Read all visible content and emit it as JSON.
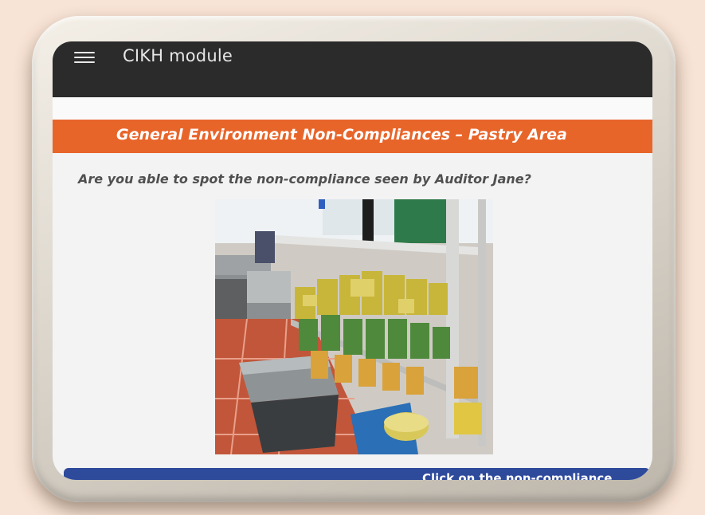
{
  "app": {
    "title": "CIKH module",
    "menu_icon": "hamburger-menu-icon"
  },
  "banner": {
    "title": "General Environment Non-Compliances – Pastry Area",
    "color": "#e8652a"
  },
  "question": "Are you able to spot the non-compliance seen by Auditor Jane?",
  "bottom_bar": {
    "label": "Click on the non-compliance",
    "color": "#2e4a9b"
  },
  "colors": {
    "appbar": "#2b2b2b",
    "page_background": "#f8e4d6"
  }
}
